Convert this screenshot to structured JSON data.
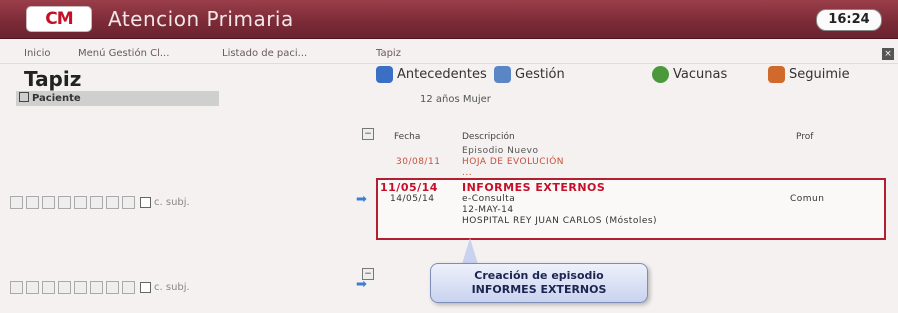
{
  "app": {
    "logo": "CM",
    "title": "Atencion Primaria",
    "clock": "16:24"
  },
  "breadcrumb": [
    "Inicio",
    "Menú Gestión Cl...",
    "Listado de paci...",
    "Tapiz"
  ],
  "page": {
    "title": "Tapiz",
    "section": "Paciente"
  },
  "tabs": [
    {
      "label": "Antecedentes",
      "icon": "people-icon",
      "color": "#3a6fc4"
    },
    {
      "label": "Gestión",
      "icon": "folder-icon",
      "color": "#5a86c6"
    },
    {
      "label": "Vacunas",
      "icon": "syringe-icon",
      "color": "#4a9a3c"
    },
    {
      "label": "Seguimie",
      "icon": "chart-icon",
      "color": "#d06a2a"
    }
  ],
  "patient": {
    "info": "12 años  Mujer"
  },
  "row_label": "c. subj.",
  "episodes": {
    "headers": {
      "fecha": "Fecha",
      "descripcion": "Descripción",
      "prof": "Prof"
    },
    "rows": [
      {
        "fecha": "",
        "desc": "Episodio Nuevo",
        "color": "#555"
      },
      {
        "fecha": "30/08/11",
        "desc": "HOJA DE EVOLUCIÓN",
        "color": "#c8503c"
      },
      {
        "fecha": "",
        "desc": "...",
        "color": "#c8503c"
      },
      {
        "fecha": "11/05/14",
        "desc": "INFORMES EXTERNOS",
        "color": "#c4102a"
      },
      {
        "fecha": "14/05/14",
        "desc": "e-Consulta",
        "color": "#333",
        "prof": "Comun"
      },
      {
        "fecha": "",
        "desc": "12-MAY-14",
        "color": "#333"
      },
      {
        "fecha": "",
        "desc": "HOSPITAL REY JUAN CARLOS (Móstoles)",
        "color": "#333"
      }
    ]
  },
  "callout": {
    "line1": "Creación de episodio",
    "line2": "INFORMES EXTERNOS"
  },
  "colors": {
    "titlebar": "#7a2a36",
    "highlight_border": "#b02030",
    "callout_bg": "#c9d3ef"
  }
}
